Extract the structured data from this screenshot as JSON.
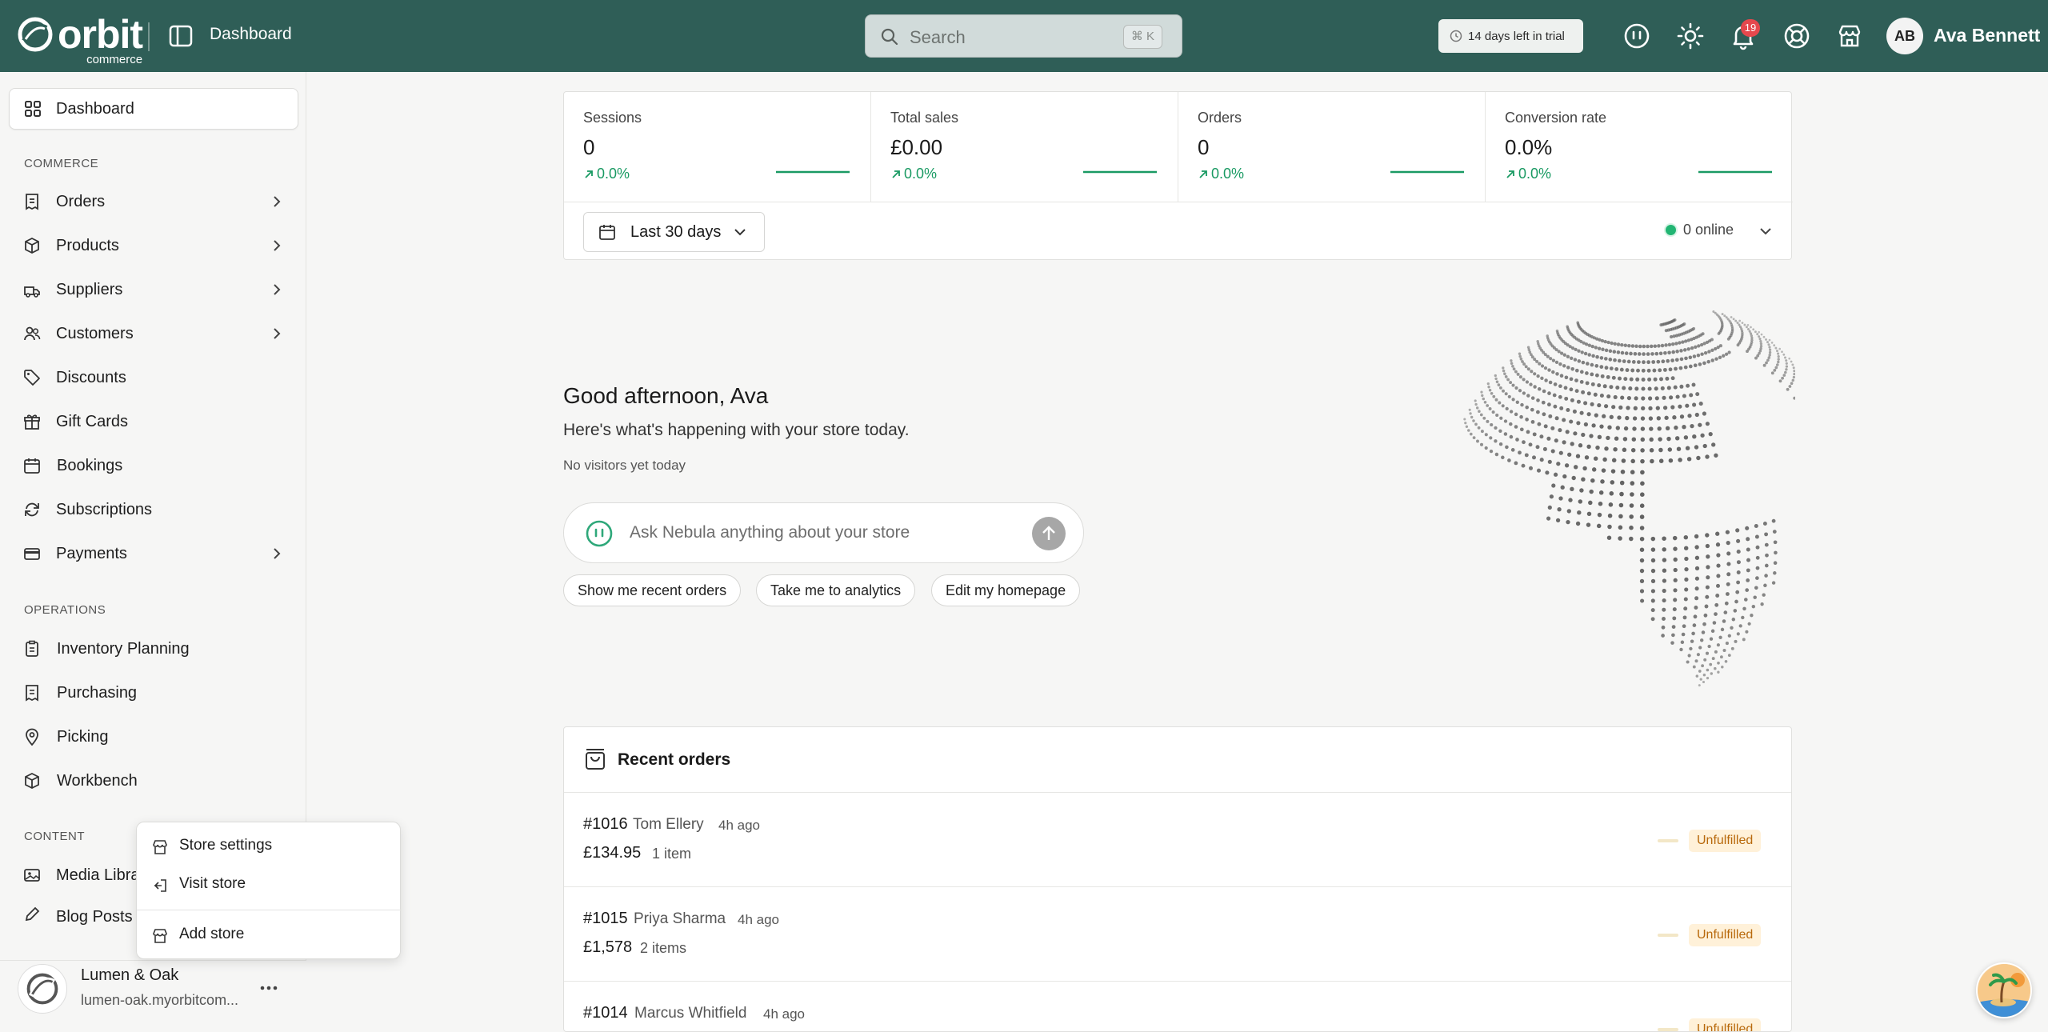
{
  "topbar": {
    "logo_word": "orbit",
    "logo_sub": "commerce",
    "page_title": "Dashboard",
    "search_placeholder": "Search",
    "search_shortcut": "⌘ K",
    "trial_label": "14 days left in trial",
    "notification_count": "19",
    "user_initials": "AB",
    "user_name": "Ava Bennett",
    "icons": [
      "nebula-icon",
      "sun-icon",
      "bell-icon",
      "help-icon",
      "store-icon"
    ]
  },
  "sidebar": {
    "dashboard": "Dashboard",
    "sections": {
      "commerce": "COMMERCE",
      "operations": "OPERATIONS",
      "content": "CONTENT"
    },
    "commerce_items": [
      {
        "label": "Orders",
        "icon": "orders-icon",
        "has_children": true
      },
      {
        "label": "Products",
        "icon": "box-icon",
        "has_children": true
      },
      {
        "label": "Suppliers",
        "icon": "supplier-icon",
        "has_children": true
      },
      {
        "label": "Customers",
        "icon": "users-icon",
        "has_children": true
      },
      {
        "label": "Discounts",
        "icon": "tag-icon",
        "has_children": false
      },
      {
        "label": "Gift Cards",
        "icon": "gift-icon",
        "has_children": false
      },
      {
        "label": "Bookings",
        "icon": "calendar-icon",
        "has_children": false
      },
      {
        "label": "Subscriptions",
        "icon": "refresh-icon",
        "has_children": false
      },
      {
        "label": "Payments",
        "icon": "credit-card-icon",
        "has_children": true
      }
    ],
    "operations_items": [
      {
        "label": "Inventory Planning",
        "icon": "clipboard-icon"
      },
      {
        "label": "Purchasing",
        "icon": "receipt-icon"
      },
      {
        "label": "Picking",
        "icon": "map-pin-icon"
      },
      {
        "label": "Workbench",
        "icon": "cube-icon"
      }
    ],
    "content_items": [
      {
        "label": "Media Libra",
        "icon": "image-icon"
      },
      {
        "label": "Blog Posts",
        "icon": "pen-icon"
      }
    ],
    "store": {
      "name": "Lumen & Oak",
      "url": "lumen-oak.myorbitcom..."
    },
    "store_menu": {
      "settings": "Store settings",
      "visit": "Visit store",
      "add": "Add store"
    }
  },
  "stats": [
    {
      "label": "Sessions",
      "value": "0",
      "change": "0.0%"
    },
    {
      "label": "Total sales",
      "value": "£0.00",
      "change": "0.0%"
    },
    {
      "label": "Orders",
      "value": "0",
      "change": "0.0%"
    },
    {
      "label": "Conversion rate",
      "value": "0.0%",
      "change": "0.0%"
    }
  ],
  "range": {
    "label": "Last 30 days"
  },
  "online": {
    "label": "0 online"
  },
  "welcome": {
    "greeting": "Good afternoon, Ava",
    "subtext": "Here's what's happening with your store today.",
    "visitors": "No visitors yet today",
    "ask_placeholder": "Ask Nebula anything about your store",
    "chips": [
      "Show me recent orders",
      "Take me to analytics",
      "Edit my homepage"
    ]
  },
  "recent_orders": {
    "title": "Recent orders",
    "rows": [
      {
        "number": "#1016",
        "customer": "Tom Ellery",
        "time": "4h ago",
        "amount": "£134.95",
        "items": "1 item",
        "status": "Unfulfilled"
      },
      {
        "number": "#1015",
        "customer": "Priya Sharma",
        "time": "4h ago",
        "amount": "£1,578",
        "items": "2 items",
        "status": "Unfulfilled"
      },
      {
        "number": "#1014",
        "customer": "Marcus Whitfield",
        "time": "4h ago",
        "amount": "",
        "items": "",
        "status": "Unfulfilled"
      }
    ]
  },
  "colors": {
    "topbar": "#2f5e57",
    "positive": "#1a9a63",
    "status_unfulfilled": "#b8690c",
    "notification": "#e5484d"
  }
}
